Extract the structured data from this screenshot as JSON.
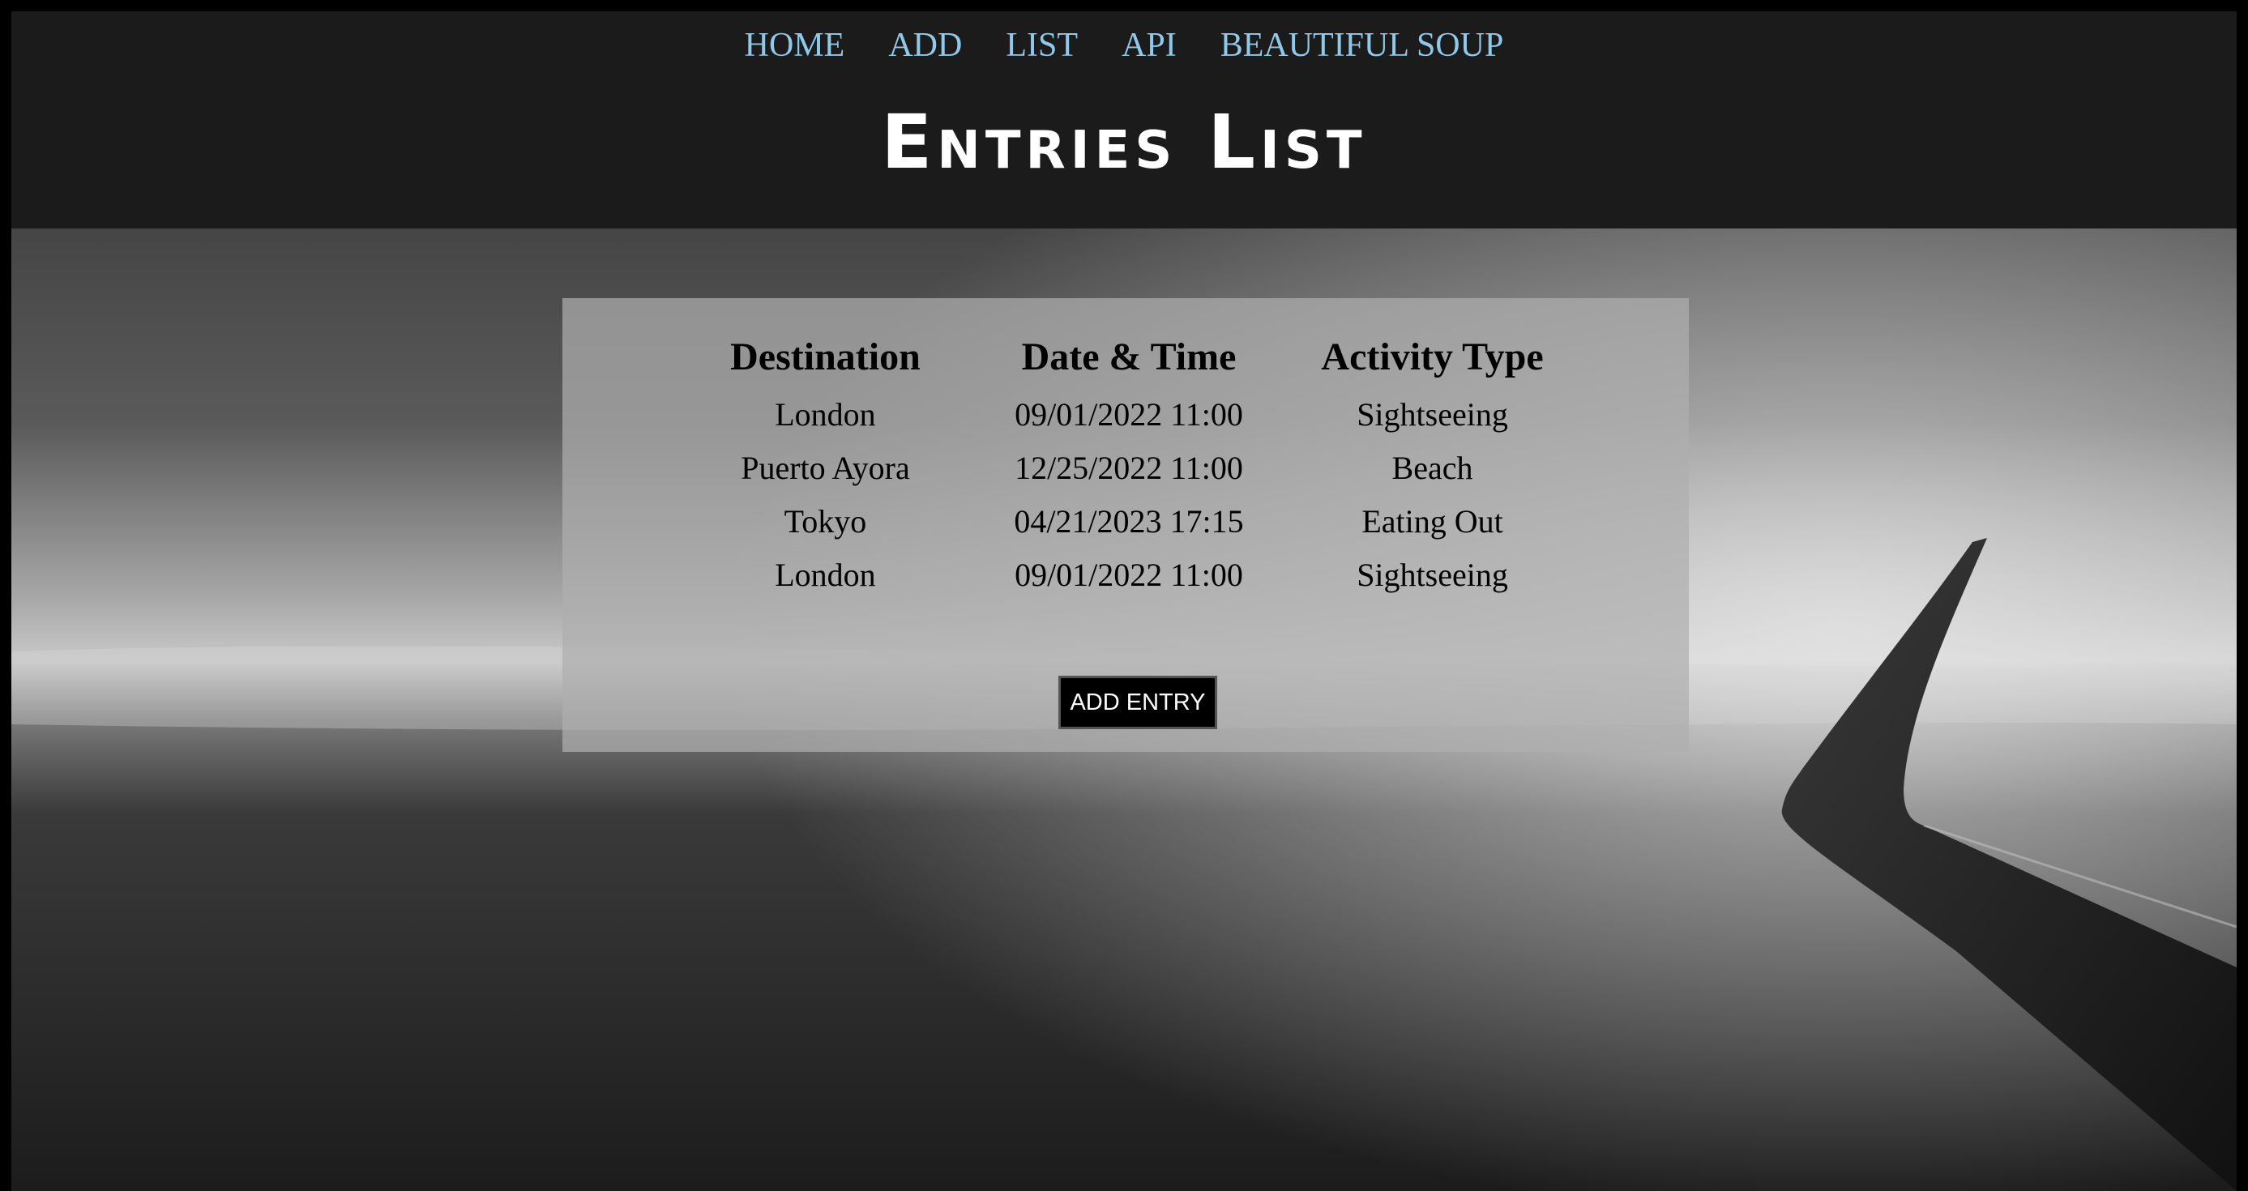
{
  "nav": {
    "items": [
      "HOME",
      "ADD",
      "LIST",
      "API",
      "BEAUTIFUL SOUP"
    ]
  },
  "header": {
    "title": "Entries List"
  },
  "table": {
    "headers": [
      "Destination",
      "Date & Time",
      "Activity Type"
    ],
    "rows": [
      [
        "London",
        "09/01/2022 11:00",
        "Sightseeing"
      ],
      [
        "Puerto Ayora",
        "12/25/2022 11:00",
        "Beach"
      ],
      [
        "Tokyo",
        "04/21/2023 17:15",
        "Eating Out"
      ],
      [
        "London",
        "09/01/2022 11:00",
        "Sightseeing"
      ]
    ]
  },
  "actions": {
    "add_entry_label": "ADD ENTRY"
  },
  "colors": {
    "nav_link": "#8fc8e8",
    "header_bg": "#1b1b1b",
    "button_bg": "#000000"
  }
}
